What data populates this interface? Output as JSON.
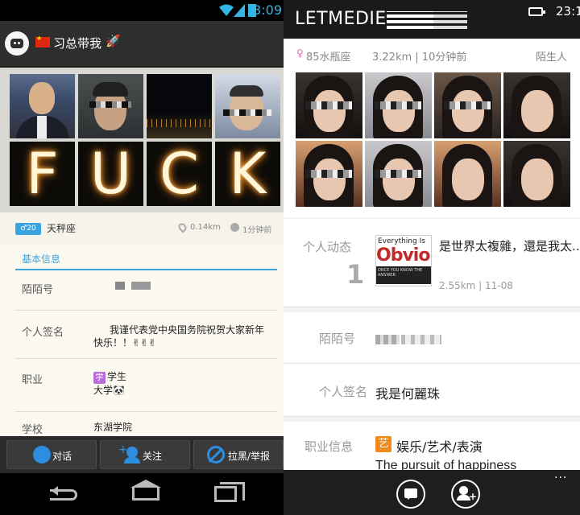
{
  "left": {
    "status": {
      "time": "3:09"
    },
    "header": {
      "title": "习总带我",
      "rocket": "🚀"
    },
    "letters": [
      "F",
      "U",
      "C",
      "K"
    ],
    "meta": {
      "badge": "♂20",
      "zodiac": "天秤座",
      "distance": "0.14km",
      "ago": "1分钟前"
    },
    "tab": "基本信息",
    "rows": {
      "id_label": "陌陌号",
      "sig_label": "个人签名",
      "sig_value": "我谨代表党中央国务院祝贺大家新年快乐！！✌✌✌",
      "job_label": "职业",
      "job_icon": "学",
      "job_value": "学生",
      "job_sub": "大学🐼",
      "school_label": "学校",
      "school_value": "东湖学院"
    },
    "buttons": {
      "chat": "对话",
      "follow": "关注",
      "block": "拉黑/举报"
    }
  },
  "right": {
    "title": "LETMEDIE",
    "time": "23:1",
    "meta": {
      "gender": "♀",
      "age": "85水瓶座",
      "distance": "3.22km | 10分钟前",
      "relation": "陌生人"
    },
    "feed": {
      "label": "个人动态",
      "count": "1",
      "cover_top": "Everything Is",
      "cover_word": "Obvious",
      "cover_small": "ONCE YOU KNOW THE ANSWER",
      "text": "是世界太複雜，還是我太...",
      "sub": "2.55km | 11-08"
    },
    "rows": {
      "id_label": "陌陌号",
      "sig_label": "个人签名",
      "sig_value": "我是何麗珠",
      "job_label": "职业信息",
      "job_icon": "艺",
      "job_value": "娱乐/艺术/表演",
      "job_sub": "The pursuit of happiness"
    },
    "more": "···"
  }
}
